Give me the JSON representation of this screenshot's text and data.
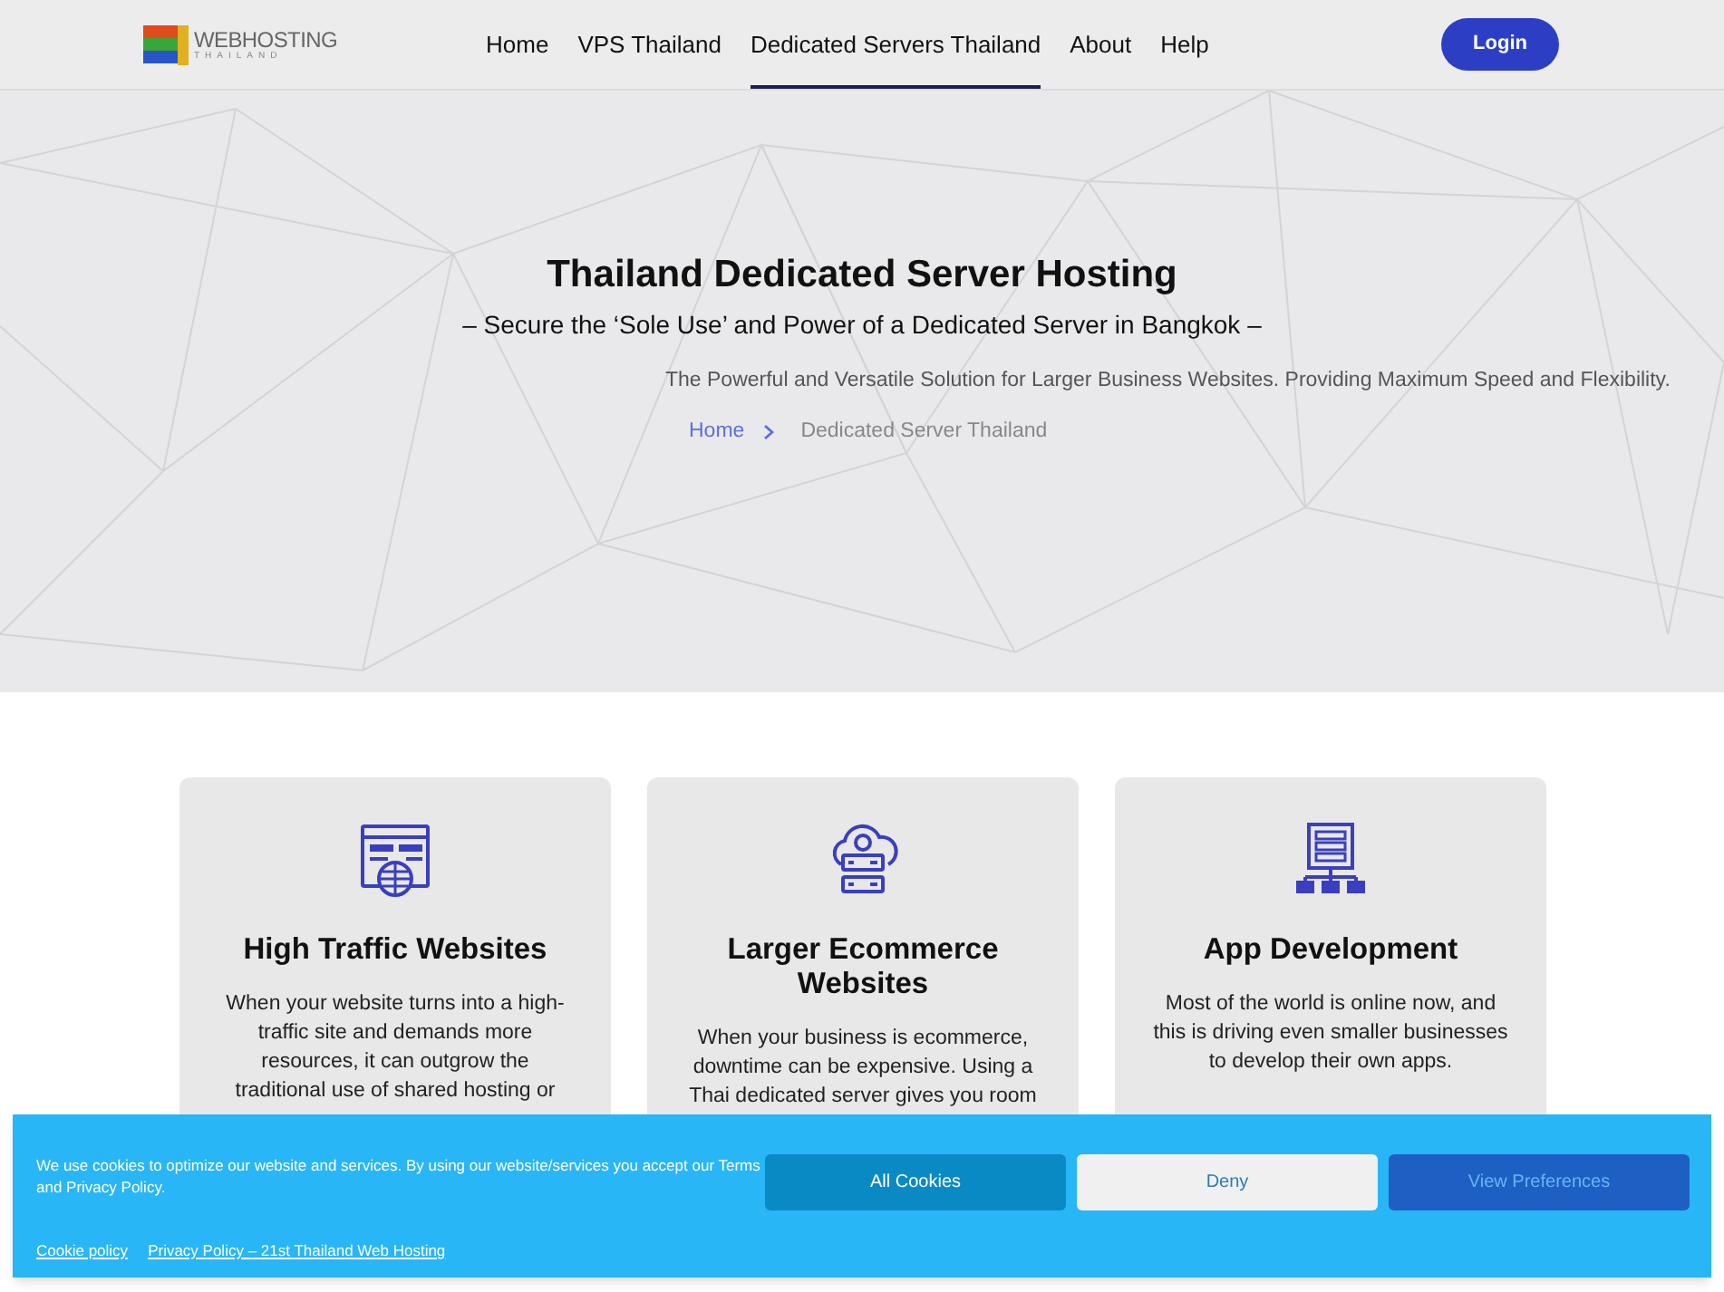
{
  "header": {
    "logo": {
      "name": "WEBHOSTING",
      "tagline": "THAILAND"
    },
    "nav": [
      {
        "label": "Home",
        "selected": false
      },
      {
        "label": "VPS Thailand",
        "selected": false
      },
      {
        "label": "Dedicated Servers Thailand",
        "selected": true
      },
      {
        "label": "About",
        "selected": false
      },
      {
        "label": "Help",
        "selected": false
      }
    ],
    "login": "Login"
  },
  "hero": {
    "title": "Thailand Dedicated Server Hosting",
    "subtitle": "– Secure the ‘Sole Use’ and Power of a Dedicated Server in Bangkok –",
    "description": "The Powerful and Versatile Solution for Larger Business Websites. Providing Maximum Speed and Flexibility.",
    "breadcrumb": [
      "Home",
      "Dedicated Server Thailand"
    ]
  },
  "cards": [
    {
      "kind": "web",
      "title": "High Traffic Websites",
      "lines": [
        "When your website turns into a high-",
        "traffic site and demands more",
        "resources, it can outgrow the",
        "traditional use of shared hosting or"
      ]
    },
    {
      "kind": "cloud",
      "title": "Larger Ecommerce Websites",
      "lines": [
        "When your business is ecommerce,",
        "downtime can be expensive. Using a",
        "Thai dedicated server gives you room"
      ]
    },
    {
      "kind": "network",
      "title": "App Development",
      "lines": [
        "Most of the world is online now, and",
        "this is driving even smaller businesses",
        "to develop their own apps."
      ]
    }
  ],
  "cookie_banner": {
    "message": "We use cookies to optimize our website and services. By using our website/services you accept our Terms and Privacy Policy.",
    "buttons": [
      {
        "kind": "accept",
        "label": "All Cookies"
      },
      {
        "kind": "deny",
        "label": "Deny"
      },
      {
        "kind": "prefs",
        "label": "View Preferences"
      }
    ],
    "links": [
      "Cookie policy",
      "Privacy Policy – 21st Thailand Web Hosting"
    ]
  }
}
